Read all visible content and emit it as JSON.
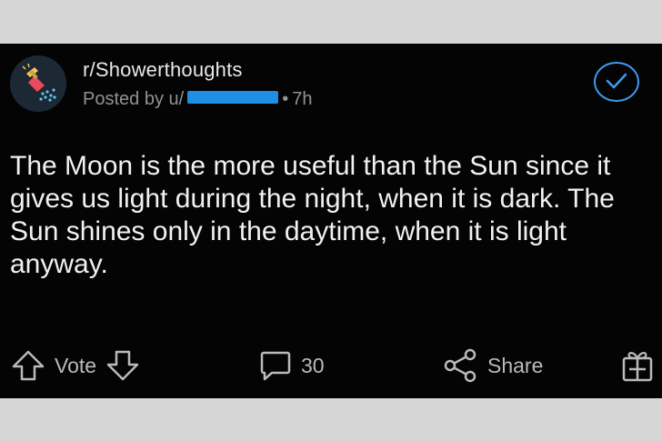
{
  "post": {
    "subreddit": "r/Showerthoughts",
    "posted_by_prefix": "Posted by u/",
    "time": "7h",
    "body": "The Moon is the more useful than the Sun since it gives us light during the night, when it is dark. The Sun shines only in the daytime, when it is light anyway."
  },
  "actions": {
    "vote_label": "Vote",
    "comment_count": "30",
    "share_label": "Share"
  },
  "colors": {
    "post_bg": "#040404",
    "page_bg": "#d6d6d6",
    "accent_blue": "#3f9af3",
    "redaction_blue": "#1f8fe6"
  },
  "icons": [
    "subreddit-avatar-icon",
    "verified-check-icon",
    "upvote-arrow-icon",
    "downvote-arrow-icon",
    "comment-bubble-icon",
    "share-icon",
    "award-gift-icon"
  ]
}
